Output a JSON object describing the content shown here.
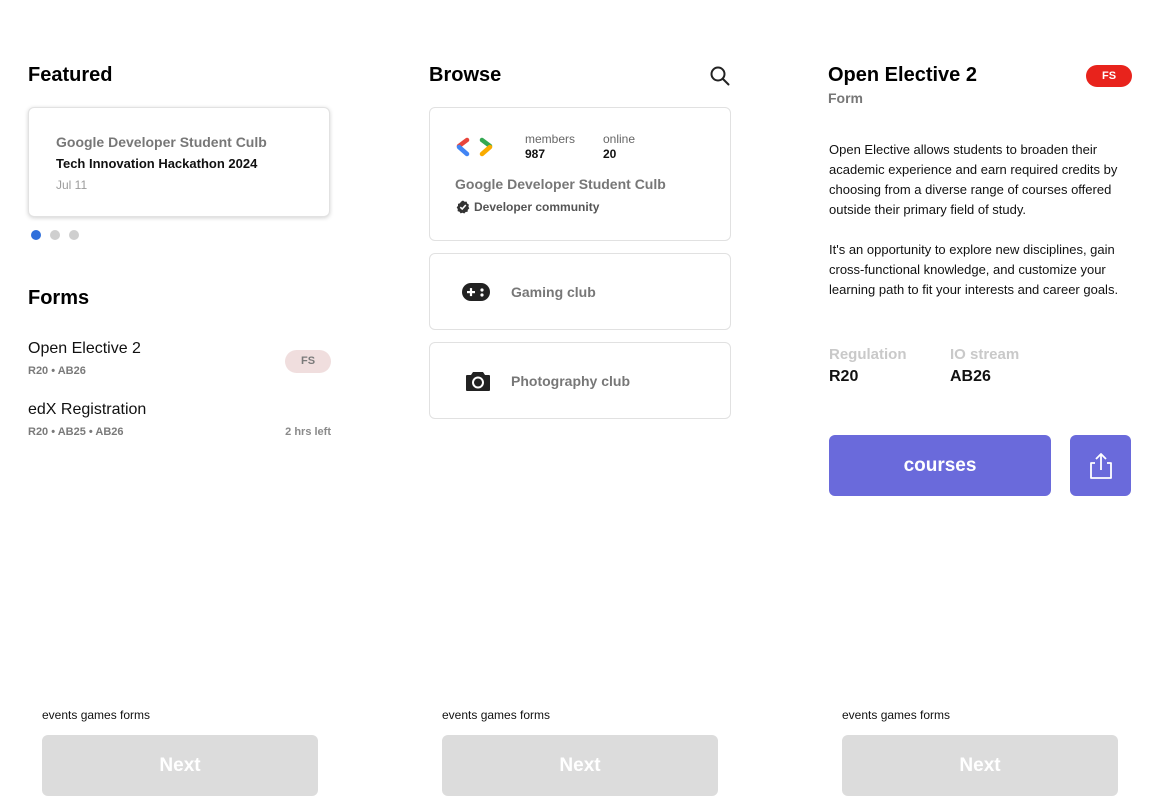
{
  "featured": {
    "heading": "Featured",
    "card": {
      "org": "Google Developer Student Culb",
      "title": "Tech Innovation Hackathon 2024",
      "date": "Jul 11"
    },
    "carousel": {
      "pages": 3,
      "active": 1,
      "active_color": "#2f6fdb",
      "inactive_color": "#cfcfcf"
    }
  },
  "forms": {
    "heading": "Forms",
    "items": [
      {
        "title": "Open Elective 2",
        "sub": "R20 • AB26",
        "badge": "FS"
      },
      {
        "title": "edX  Registration",
        "sub": "R20 • AB25 • AB26",
        "status": "2 hrs left"
      }
    ]
  },
  "browse": {
    "heading": "Browse",
    "search_icon": "search-icon",
    "community": {
      "name": "Google Developer Student Culb",
      "members_label": "members",
      "members": "987",
      "online_label": "online",
      "online": "20",
      "tag": "Developer community",
      "logo_icon": "gdsc-logo"
    },
    "clubs": [
      {
        "name": "Gaming club",
        "icon": "gamepad-icon"
      },
      {
        "name": "Photography club",
        "icon": "camera-icon"
      }
    ]
  },
  "detail": {
    "title": "Open Elective 2",
    "subtitle": "Form",
    "badge": "FS",
    "badge_color": "#e8231c",
    "paragraph1": "Open Elective allows students to broaden their academic experience and earn required credits by choosing from a diverse range of courses offered outside their primary field of study.",
    "paragraph2": "It's an opportunity to explore new disciplines, gain cross-functional knowledge, and customize your learning path to fit your interests and career goals.",
    "regulation_label": "Regulation",
    "regulation": "R20",
    "stream_label": "IO stream",
    "stream": "AB26",
    "primary_button": "courses",
    "accent": "#6a6adb",
    "share_icon": "share-icon"
  },
  "bottom": [
    {
      "label": "events games forms",
      "button": "Next"
    },
    {
      "label": "events games forms",
      "button": "Next"
    },
    {
      "label": "events games forms",
      "button": "Next"
    }
  ]
}
